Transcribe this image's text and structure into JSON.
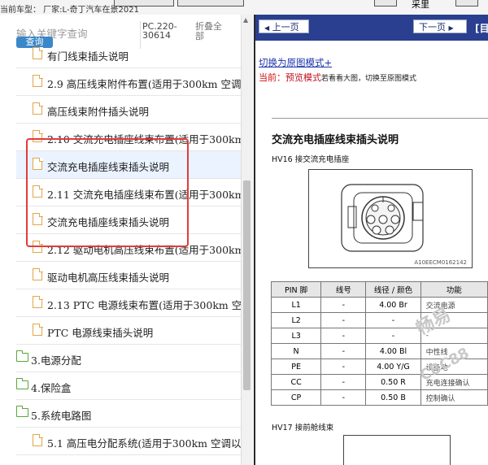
{
  "topbar": {
    "vehicle_label": "当前车型：  厂家:L-奇丁汽车在景2021",
    "right_label": "采里"
  },
  "left": {
    "search": {
      "placeholder": "输入关键字查询",
      "button": "查询"
    },
    "manual_code": "PC.220-30614",
    "collapse_all": "折叠全部",
    "tree": [
      {
        "type": "doc",
        "label": "有门线束插头说明"
      },
      {
        "type": "doc",
        "label": "2.9 高压线束附件布置(适用于300km 空调"
      },
      {
        "type": "doc",
        "label": "高压线束附件插头说明"
      },
      {
        "type": "doc",
        "label": "2.10 交流充电插座线束布置(适用于300km"
      },
      {
        "type": "doc",
        "label": "交流充电插座线束插头说明",
        "selected": true
      },
      {
        "type": "doc",
        "label": "2.11 交流充电插座线束布置(适用于300km"
      },
      {
        "type": "doc",
        "label": "交流充电插座线束插头说明"
      },
      {
        "type": "doc",
        "label": "2.12 驱动电机高压线束布置(适用于300km"
      },
      {
        "type": "doc",
        "label": "驱动电机高压线束插头说明"
      },
      {
        "type": "doc",
        "label": "2.13 PTC 电源线束布置(适用于300km 空调"
      },
      {
        "type": "doc",
        "label": "PTC 电源线束插头说明"
      },
      {
        "type": "folder",
        "label": "3.电源分配"
      },
      {
        "type": "folder",
        "label": "4.保险盒"
      },
      {
        "type": "folder",
        "label": "5.系统电路图"
      },
      {
        "type": "doc",
        "label": "5.1 高压电分配系统(适用于300km 空调以"
      }
    ]
  },
  "right": {
    "nav": {
      "prev": "上一页",
      "next": "下一页",
      "extra": "[目"
    },
    "switch_link": "切换为原图模式+",
    "mode": {
      "prefix": "当前：",
      "name": "预览模式",
      "hint": "若看看大图，切换至原图模式"
    },
    "doc_title": "交流充电插座线束插头说明",
    "connector1": {
      "caption": "HV16 接交流充电插座",
      "ref": "A10EECM0162142"
    },
    "pin_table": {
      "headers": [
        "PIN 脚",
        "线号",
        "线径 / 颜色",
        "功能"
      ],
      "rows": [
        [
          "L1",
          "-",
          "4.00 Br",
          "交流电源"
        ],
        [
          "L2",
          "-",
          "-",
          "-"
        ],
        [
          "L3",
          "-",
          "-",
          "-"
        ],
        [
          "N",
          "-",
          "4.00 Bl",
          "中性线"
        ],
        [
          "PE",
          "-",
          "4.00 Y/G",
          "设备地"
        ],
        [
          "CC",
          "-",
          "0.50 R",
          "充电连接确认"
        ],
        [
          "CP",
          "-",
          "0.50 B",
          "控制确认"
        ]
      ]
    },
    "connector2": {
      "caption": "HV17 接前舱线束"
    },
    "watermarks": [
      "畅易",
      "CBC88"
    ]
  },
  "colors": {
    "nav_bg": "#2a3f8f",
    "highlight": "#e23b3b",
    "query_button": "#3a87c9"
  }
}
